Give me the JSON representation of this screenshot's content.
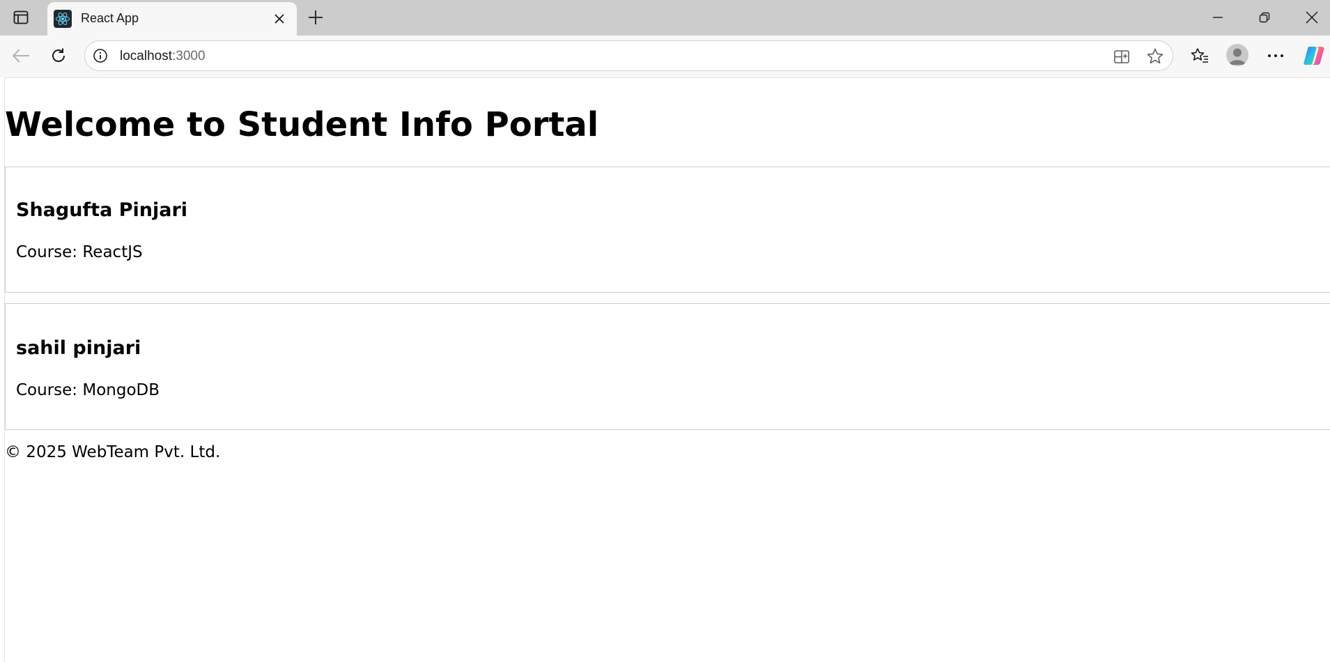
{
  "browser": {
    "tab": {
      "title": "React App"
    },
    "address": {
      "host": "localhost",
      "port": ":3000"
    }
  },
  "page": {
    "title": "Welcome to Student Info Portal",
    "students": [
      {
        "name": "Shagufta Pinjari",
        "course": "Course: ReactJS"
      },
      {
        "name": "sahil pinjari",
        "course": "Course: MongoDB"
      }
    ],
    "footer": "© 2025 WebTeam Pvt. Ltd."
  },
  "colors": {
    "tabstrip": "#cccccc",
    "toolbar": "#f7f7f7",
    "card_border": "#cfcfcf",
    "react_logo": "#61dafb"
  },
  "icons": [
    "tab-actions-icon",
    "react-logo-icon",
    "close-icon",
    "plus-icon",
    "minimize-icon",
    "restore-icon",
    "window-close-icon",
    "back-arrow-icon",
    "refresh-icon",
    "info-icon",
    "split-screen-icon",
    "star-icon",
    "favorites-icon",
    "profile-avatar",
    "more-icon",
    "copilot-icon"
  ]
}
